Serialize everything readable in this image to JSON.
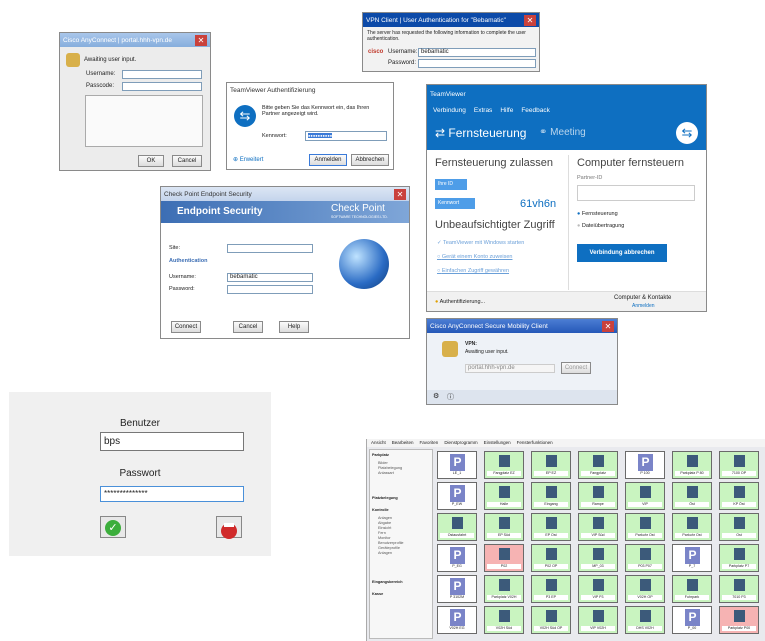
{
  "cisco_small": {
    "title": "Cisco AnyConnect | portal.hhh-vpn.de",
    "status": "Awaiting user input.",
    "username_label": "Username:",
    "passcode_label": "Passcode:",
    "ok": "OK",
    "cancel": "Cancel"
  },
  "vpn_client": {
    "title": "VPN Client | User Authentication for \"Bebamatic\"",
    "message": "The server has requested the following information to complete the user authentication.",
    "username_label": "Username:",
    "username_value": "bebamatic",
    "password_label": "Password:"
  },
  "tv_auth": {
    "title": "TeamViewer Authentifizierung",
    "message": "Bitte geben Sie das Kennwort ein, das Ihren Partner angezeigt wird.",
    "password_label": "Kennwort:",
    "password_value": "●●●●●●●●●●",
    "advanced": "Erweitert",
    "login": "Anmelden",
    "cancel": "Abbrechen"
  },
  "tv_main": {
    "title": "TeamViewer",
    "menu": [
      "Verbindung",
      "Extras",
      "Hilfe",
      "Feedback"
    ],
    "tab_remote": "Fernsteuerung",
    "tab_meeting": "Meeting",
    "allow_heading": "Fernsteuerung zulassen",
    "your_id_label": "Ihre ID",
    "password_label": "Kennwort",
    "password_value": "61vh6n",
    "unattended_heading": "Unbeaufsichtigter Zugriff",
    "item1": "TeamViewer mit Windows starten",
    "item2": "Gerät einem Konto zuweisen",
    "item3": "Einfachen Zugriff gewähren",
    "control_heading": "Computer fernsteuern",
    "partner_id_label": "Partner-ID",
    "radio_remote": "Fernsteuerung",
    "radio_transfer": "Dateiübertragung",
    "abort_button": "Verbindung abbrechen",
    "status": "Authentifizierung...",
    "contacts": "Computer & Kontakte",
    "contacts_sub": "Anmelden"
  },
  "checkpoint": {
    "title": "Check Point Endpoint Security",
    "header": "Endpoint Security",
    "brand": "Check Point",
    "brand_sub": "SOFTWARE TECHNOLOGIES LTD.",
    "site_label": "Site:",
    "auth_heading": "Authentication",
    "username_label": "Username:",
    "username_value": "bebamatic",
    "password_label": "Password:",
    "connect": "Connect",
    "cancel": "Cancel",
    "help": "Help"
  },
  "cisco_mobility": {
    "title": "Cisco AnyConnect Secure Mobility Client",
    "section": "VPN:",
    "status": "Awaiting user input.",
    "host": "portal.hhh-vpn.de",
    "connect": "Connect"
  },
  "login": {
    "user_label": "Benutzer",
    "user_value": "bps",
    "pass_label": "Passwort",
    "pass_value": "**************"
  },
  "parking": {
    "menu": [
      "Ansicht",
      "Bearbeiten",
      "Favoriten",
      "Dienstprogramm",
      "Einstellungen",
      "Fensterfunktionen"
    ],
    "sidebar_sections": [
      "Parkplatz",
      "Platzbelegung",
      "Kontrolle",
      "Eingangsbereich",
      "Kasse"
    ],
    "sidebar_items": [
      "Bilder",
      "Platzbelegung",
      "Anlassart",
      "Anlagen",
      "Abgabe",
      "Einsicht",
      "Fern",
      "Monitor",
      "Benutzerprofile",
      "Geräteprofile",
      "Anlagen"
    ],
    "cells": [
      [
        "P",
        "LE_1",
        "Free"
      ],
      [
        "",
        "Fangplatz EZ",
        "Occ"
      ],
      [
        "",
        "EP EZ",
        "Occ"
      ],
      [
        "",
        "Fangplatz",
        "Occ"
      ],
      [
        "P",
        "P 100",
        "Free"
      ],
      [
        "",
        "Parkplatz P 80",
        "Occ"
      ],
      [
        "",
        "7100 OP",
        "Occ"
      ],
      [
        "P",
        "P_EW",
        "Free"
      ],
      [
        "",
        "Halle",
        "Occ"
      ],
      [
        "",
        "Eingang",
        "Occ"
      ],
      [
        "",
        "Rampe",
        "Occ"
      ],
      [
        "",
        "VIP",
        "Occ"
      ],
      [
        "",
        "Öst",
        "Occ"
      ],
      [
        "",
        "KP Öst",
        "Occ"
      ],
      [
        "",
        "Ostausfahrt",
        "Occ"
      ],
      [
        "",
        "EP Süd",
        "Occ"
      ],
      [
        "",
        "EP Ost",
        "Occ"
      ],
      [
        "",
        "VIP Süd",
        "Occ"
      ],
      [
        "",
        "Parkuhr Ost",
        "Occ"
      ],
      [
        "",
        "Parkuhr Ost",
        "Occ"
      ],
      [
        "",
        "Ost",
        "Occ"
      ],
      [
        "P",
        "P_EG",
        "Free"
      ],
      [
        "",
        "P02",
        "Red"
      ],
      [
        "",
        "P02 OP",
        "Occ"
      ],
      [
        "",
        "MP_03",
        "Occ"
      ],
      [
        "",
        "P03 P07",
        "Occ"
      ],
      [
        "P",
        "P_7",
        "Free"
      ],
      [
        "",
        "Parkplatz P7",
        "Occ"
      ],
      [
        "P",
        "P 3102M",
        "Free"
      ],
      [
        "",
        "Parkplatz V02H",
        "Occ"
      ],
      [
        "",
        "P3 EP",
        "Occ"
      ],
      [
        "",
        "VIP P3",
        "Occ"
      ],
      [
        "",
        "V02H OP",
        "Occ"
      ],
      [
        "",
        "Fuhrpark",
        "Occ"
      ],
      [
        "",
        "7010 P3",
        "Occ"
      ],
      [
        "P",
        "V02H EG",
        "Free"
      ],
      [
        "",
        "V02H Süd",
        "Occ"
      ],
      [
        "",
        "V02H Süd OP",
        "Occ"
      ],
      [
        "",
        "VIP V02H",
        "Occ"
      ],
      [
        "",
        "DHS V02H",
        "Occ"
      ],
      [
        "P",
        "P_00",
        "Free"
      ],
      [
        "",
        "Parkplatz P00",
        "Red"
      ]
    ]
  }
}
